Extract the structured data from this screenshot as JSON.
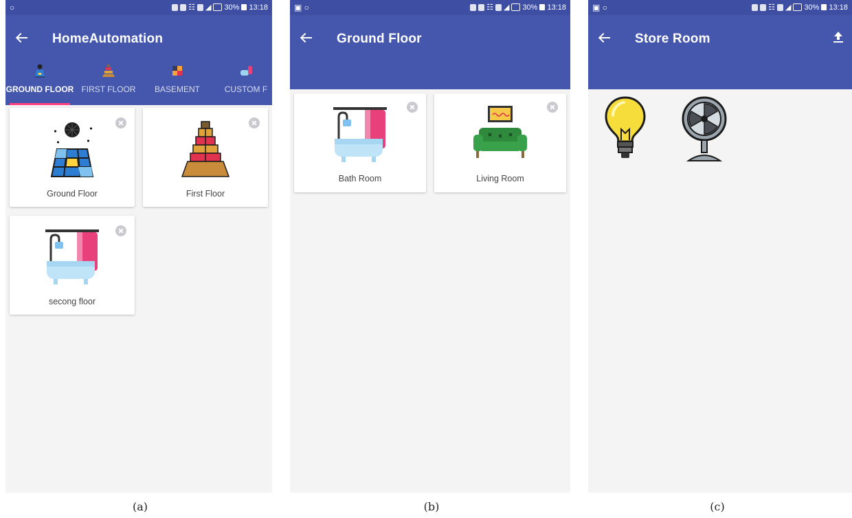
{
  "screens": {
    "a": {
      "status_time": "13:18",
      "status_battery": "30%",
      "title": "HomeAutomation",
      "tabs": [
        {
          "label": "GROUND FLOOR",
          "icon": "dance-floor-icon",
          "active": true
        },
        {
          "label": "FIRST FLOOR",
          "icon": "pagoda-floor-icon",
          "active": false
        },
        {
          "label": "BASEMENT",
          "icon": "basement-icon",
          "active": false
        },
        {
          "label": "CUSTOM F",
          "icon": "custom-floor-icon",
          "active": false
        }
      ],
      "cards": [
        {
          "label": "Ground Floor",
          "icon": "dance-floor-icon"
        },
        {
          "label": "First Floor",
          "icon": "pagoda-floor-icon"
        },
        {
          "label": "secong floor",
          "icon": "bathtub-icon"
        }
      ]
    },
    "b": {
      "status_time": "13:18",
      "status_battery": "30%",
      "title": "Ground Floor",
      "cards": [
        {
          "label": "Bath Room",
          "icon": "bathtub-icon"
        },
        {
          "label": "Living Room",
          "icon": "sofa-icon"
        }
      ]
    },
    "c": {
      "status_time": "13:18",
      "status_battery": "30%",
      "title": "Store Room",
      "devices": [
        {
          "name": "light-bulb-icon"
        },
        {
          "name": "fan-icon"
        }
      ]
    }
  },
  "captions": [
    "(a)",
    "(b)",
    "(c)"
  ],
  "colors": {
    "appbar": "#4457ad",
    "statusbar": "#3d4ea3",
    "tab_indicator": "#ff4081",
    "background": "#f4f4f5"
  }
}
